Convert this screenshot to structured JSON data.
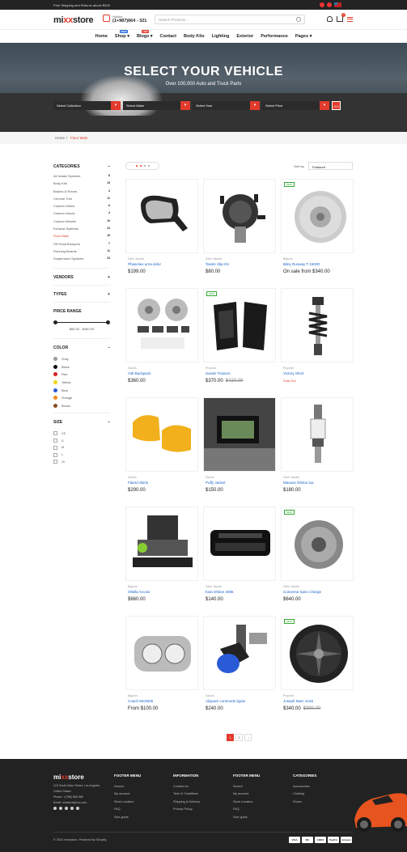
{
  "topbar": {
    "message": "Free Shipping and Returns above $200"
  },
  "header": {
    "logo_pre": "mi",
    "logo_xx": "xx",
    "logo_post": "store",
    "hotline_label": "Hotline",
    "phone": "(1+987)664 - 321",
    "search_placeholder": "Search Products...",
    "cart_count": "0"
  },
  "nav": {
    "items": [
      {
        "label": "Home"
      },
      {
        "label": "Shop",
        "tag": "NEW",
        "tag_color": "#2a6fdb"
      },
      {
        "label": "Blogs",
        "tag": "HOT",
        "tag_color": "#e23a2c"
      },
      {
        "label": "Contact"
      },
      {
        "label": "Body Kits"
      },
      {
        "label": "Lighting"
      },
      {
        "label": "Exterior"
      },
      {
        "label": "Performance"
      },
      {
        "label": "Pages"
      }
    ]
  },
  "hero": {
    "title": "SELECT YOUR VEHICLE",
    "subtitle": "Over 100,000 Auto and Truck Parts",
    "selects": [
      "Select Collection",
      "Select Make",
      "Select Year",
      "Select Price"
    ],
    "go_label": "GO"
  },
  "breadcrumb": {
    "home": "Home",
    "sep": "/",
    "current": "Floor Mats"
  },
  "sidebar": {
    "categories_title": "CATEGORIES",
    "categories": [
      {
        "label": "Air Intake Systems",
        "count": "8"
      },
      {
        "label": "Body Kits",
        "count": "13"
      },
      {
        "label": "Brakes & Rotors",
        "count": "4"
      },
      {
        "label": "Chrome Trim",
        "count": "11"
      },
      {
        "label": "Custom Grilles",
        "count": "6"
      },
      {
        "label": "Custom Hoods",
        "count": "4"
      },
      {
        "label": "Custom Wheels",
        "count": "10"
      },
      {
        "label": "Exhaust Systems",
        "count": "13"
      },
      {
        "label": "Floor Mats",
        "count": "15"
      },
      {
        "label": "Off Road Bumpers",
        "count": "7"
      },
      {
        "label": "Running Boards",
        "count": "11"
      },
      {
        "label": "Suspension Systems",
        "count": "13"
      }
    ],
    "vendors_title": "VENDORS",
    "types_title": "TYPES",
    "price_title": "PRICE RANGE",
    "price_range": "$80.00 - $460.00",
    "color_title": "COLOR",
    "colors": [
      {
        "label": "Gray",
        "hex": "#9a9a9a"
      },
      {
        "label": "Black",
        "hex": "#111111"
      },
      {
        "label": "Red",
        "hex": "#d82020"
      },
      {
        "label": "Yellow",
        "hex": "#f2d41a"
      },
      {
        "label": "Blue",
        "hex": "#2a5bd7"
      },
      {
        "label": "Orange",
        "hex": "#f08a1c"
      },
      {
        "label": "Brown",
        "hex": "#8a4a1e"
      }
    ],
    "size_title": "SIZE",
    "sizes": [
      "XS",
      "S",
      "M",
      "L",
      "XL"
    ]
  },
  "toolbar": {
    "sort_label": "Sort by",
    "sort_value": "Featured"
  },
  "products": [
    {
      "vendor": "Zahir Jacobe",
      "title": "Phaselius urna dolor",
      "price": "$199.00",
      "img": "mirror"
    },
    {
      "vendor": "Zahir Jacobe",
      "title": "Tassle Slip-On",
      "price": "$80.00",
      "img": "distributor"
    },
    {
      "vendor": "Bigsom",
      "title": "Biley Runway T-15000",
      "price": "On sale from $340.00",
      "img": "rotor",
      "new": "NEW"
    },
    {
      "vendor": "Soiuns",
      "title": "Volt Backpack",
      "price": "$360.00",
      "img": "brakekit"
    },
    {
      "vendor": "Proposit",
      "title": "Suede Trainers",
      "price": "$370.00",
      "old": "$420.00",
      "img": "taillights",
      "new": "NEW"
    },
    {
      "vendor": "Proposit",
      "title": "Victory Short",
      "soldout": "Sold Out",
      "img": "shock"
    },
    {
      "vendor": "Soiuns",
      "title": "Flared Skirts",
      "price": "$290.00",
      "img": "calipers"
    },
    {
      "vendor": "Soiuns",
      "title": "Puffy Jacket",
      "price": "$150.00",
      "img": "gauge"
    },
    {
      "vendor": "Zahir Jacobe",
      "title": "Maxaon Dhiton lua",
      "price": "$180.00",
      "img": "sparkplug"
    },
    {
      "vendor": "Bigsom",
      "title": "Ollalla Arcuss",
      "price": "$660.00",
      "img": "engine"
    },
    {
      "vendor": "Zahir Jacobe",
      "title": "Kain Dhiton 3086",
      "price": "$140.00",
      "img": "grille"
    },
    {
      "vendor": "Zahir Jacobe",
      "title": "Converse Spiro Charge",
      "price": "$640.00",
      "img": "cam",
      "new": "NEW"
    },
    {
      "vendor": "Bigsom",
      "title": "Coach MC6005",
      "price": "From $100.00",
      "img": "headlight"
    },
    {
      "vendor": "Soiuns",
      "title": "Aliquam commodo ligula",
      "price": "$240.00",
      "img": "intake"
    },
    {
      "vendor": "Proposit",
      "title": "Joseph Marc 4145",
      "price": "$340.00",
      "old": "$390.00",
      "img": "wheel",
      "new": "NEW"
    }
  ],
  "pagination": {
    "pages": [
      "1",
      "2"
    ],
    "next": "→"
  },
  "footer": {
    "logo_pre": "mi",
    "logo_xx": "xx",
    "logo_post": "store",
    "address": [
      "123 South Main Street, Los Angeles",
      "United States",
      "Phone: +(786) 856 880",
      "Email: mixstore@xxx.com"
    ],
    "columns": [
      {
        "title": "FOOTER MENU",
        "items": [
          "Search",
          "My account",
          "Store Location",
          "FAQ",
          "Size guide"
        ]
      },
      {
        "title": "INFORMATION",
        "items": [
          "Contact Us",
          "Term & Conditions",
          "Shipping & Delivery",
          "Privacy Policy"
        ]
      },
      {
        "title": "FOOTER MENU",
        "items": [
          "Search",
          "My account",
          "Store Location",
          "FAQ",
          "Size guide"
        ]
      },
      {
        "title": "CATEGORIES",
        "items": [
          "Accessories",
          "Clothing",
          "Shoes"
        ]
      }
    ],
    "copyright": "© 2021 mixxstore. Powered by Shopify",
    "payments": [
      "VISA",
      "MC",
      "AMEX",
      "PayPal",
      "Amazon"
    ]
  },
  "colors": {
    "accent": "#e23a2c",
    "dark": "#222222",
    "link": "#1a63c8"
  }
}
